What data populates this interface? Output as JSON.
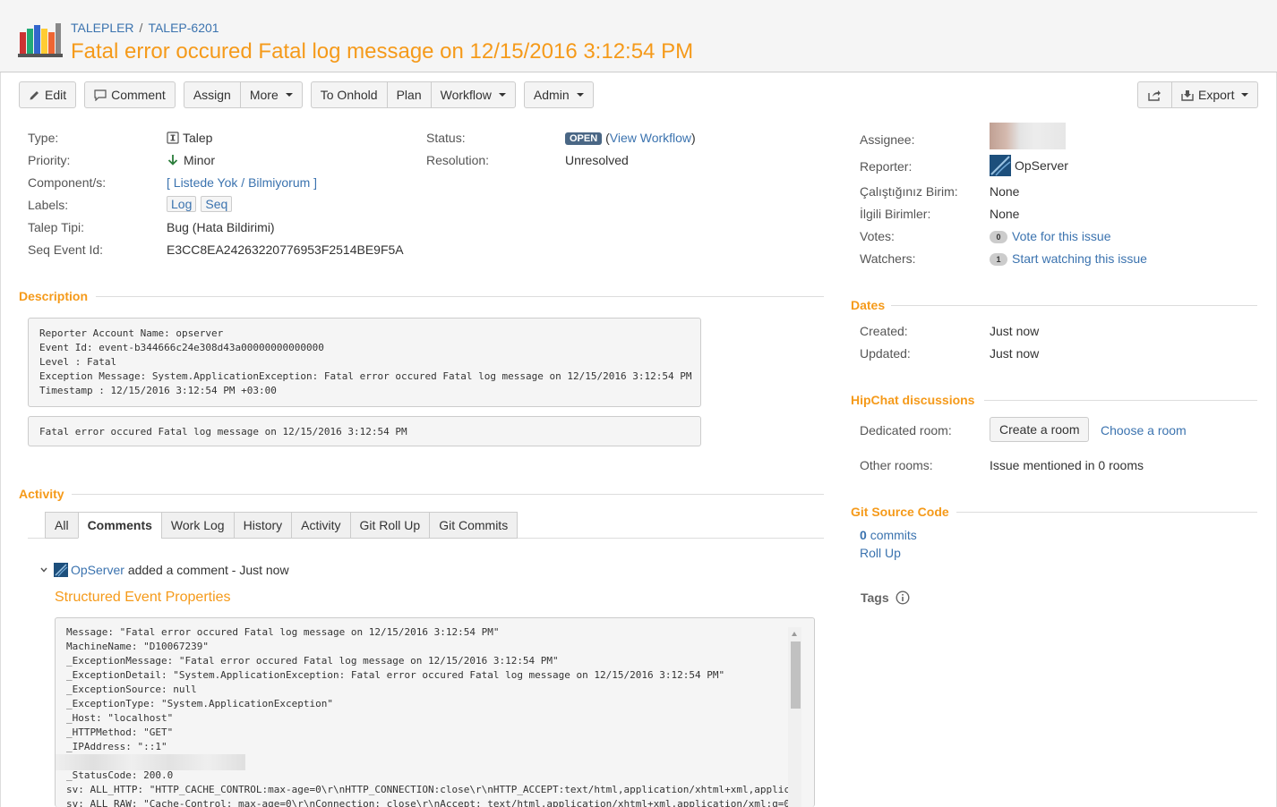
{
  "breadcrumb": {
    "project": "TALEPLER",
    "separator": "/",
    "issue_key": "TALEP-6201"
  },
  "title": "Fatal error occured Fatal log message on 12/15/2016 3:12:54 PM",
  "toolbar": {
    "edit": "Edit",
    "comment": "Comment",
    "assign": "Assign",
    "more": "More",
    "to_onhold": "To Onhold",
    "plan": "Plan",
    "workflow": "Workflow",
    "admin": "Admin",
    "export": "Export"
  },
  "details": {
    "type_label": "Type:",
    "type_value": "Talep",
    "priority_label": "Priority:",
    "priority_value": "Minor",
    "components_label": "Component/s:",
    "components_value": "[ Listede Yok / Bilmiyorum ]",
    "labels_label": "Labels:",
    "labels": [
      "Log",
      "Seq"
    ],
    "talep_tipi_label": "Talep Tipi:",
    "talep_tipi_value": "Bug (Hata Bildirimi)",
    "seq_event_label": "Seq Event Id:",
    "seq_event_value": "E3CC8EA24263220776953F2514BE9F5A",
    "status_label": "Status:",
    "status_value": "OPEN",
    "view_workflow": "View Workflow",
    "resolution_label": "Resolution:",
    "resolution_value": "Unresolved"
  },
  "description": {
    "heading": "Description",
    "block1": "Reporter Account Name: opserver\nEvent Id: event-b344666c24e308d43a00000000000000\nLevel : Fatal\nException Message: System.ApplicationException: Fatal error occured Fatal log message on 12/15/2016 3:12:54 PM\nTimestamp : 12/15/2016 3:12:54 PM +03:00",
    "block2": "Fatal error occured Fatal log message on 12/15/2016 3:12:54 PM"
  },
  "activity": {
    "heading": "Activity",
    "tabs": [
      "All",
      "Comments",
      "Work Log",
      "History",
      "Activity",
      "Git Roll Up",
      "Git Commits"
    ],
    "active_tab": "Comments",
    "comment_author": "OpServer",
    "comment_action": "added a comment - Just now",
    "comment_title": "Structured Event Properties",
    "comment_body": "Message: \"Fatal error occured Fatal log message on 12/15/2016 3:12:54 PM\"\nMachineName: \"D10067239\"\n_ExceptionMessage: \"Fatal error occured Fatal log message on 12/15/2016 3:12:54 PM\"\n_ExceptionDetail: \"System.ApplicationException: Fatal error occured Fatal log message on 12/15/2016 3:12:54 PM\"\n_ExceptionSource: null\n_ExceptionType: \"System.ApplicationException\"\n_Host: \"localhost\"\n_HTTPMethod: \"GET\"\n_IPAddress: \"::1\"\n\n_StatusCode: 200.0\nsv: ALL_HTTP: \"HTTP_CACHE_CONTROL:max-age=0\\r\\nHTTP_CONNECTION:close\\r\\nHTTP_ACCEPT:text/html,application/xhtml+xml,applic\nsv: ALL_RAW: \"Cache-Control: max-age=0\\r\\nConnection: close\\r\\nAccept: text/html,application/xhtml+xml,application/xml;q=0"
  },
  "people": {
    "assignee_label": "Assignee:",
    "reporter_label": "Reporter:",
    "reporter_value": "OpServer",
    "birim_label": "Çalıştığınız Birim:",
    "birim_value": "None",
    "ilgili_label": "İlgili Birimler:",
    "ilgili_value": "None",
    "votes_label": "Votes:",
    "votes_count": "0",
    "votes_link": "Vote for this issue",
    "watchers_label": "Watchers:",
    "watchers_count": "1",
    "watchers_link": "Start watching this issue"
  },
  "dates": {
    "heading": "Dates",
    "created_label": "Created:",
    "created_value": "Just now",
    "updated_label": "Updated:",
    "updated_value": "Just now"
  },
  "hipchat": {
    "heading": "HipChat discussions",
    "dedicated_label": "Dedicated room:",
    "create_room": "Create a room",
    "choose_room": "Choose a room",
    "other_label": "Other rooms:",
    "other_value": "Issue mentioned in 0 rooms"
  },
  "git": {
    "heading": "Git Source Code",
    "commits_count": "0",
    "commits_label": "commits",
    "roll_up": "Roll Up"
  },
  "tags": {
    "heading": "Tags"
  },
  "colors": {
    "accent": "#f59a1a",
    "link": "#3b73af",
    "status_badge": "#4a6785"
  }
}
